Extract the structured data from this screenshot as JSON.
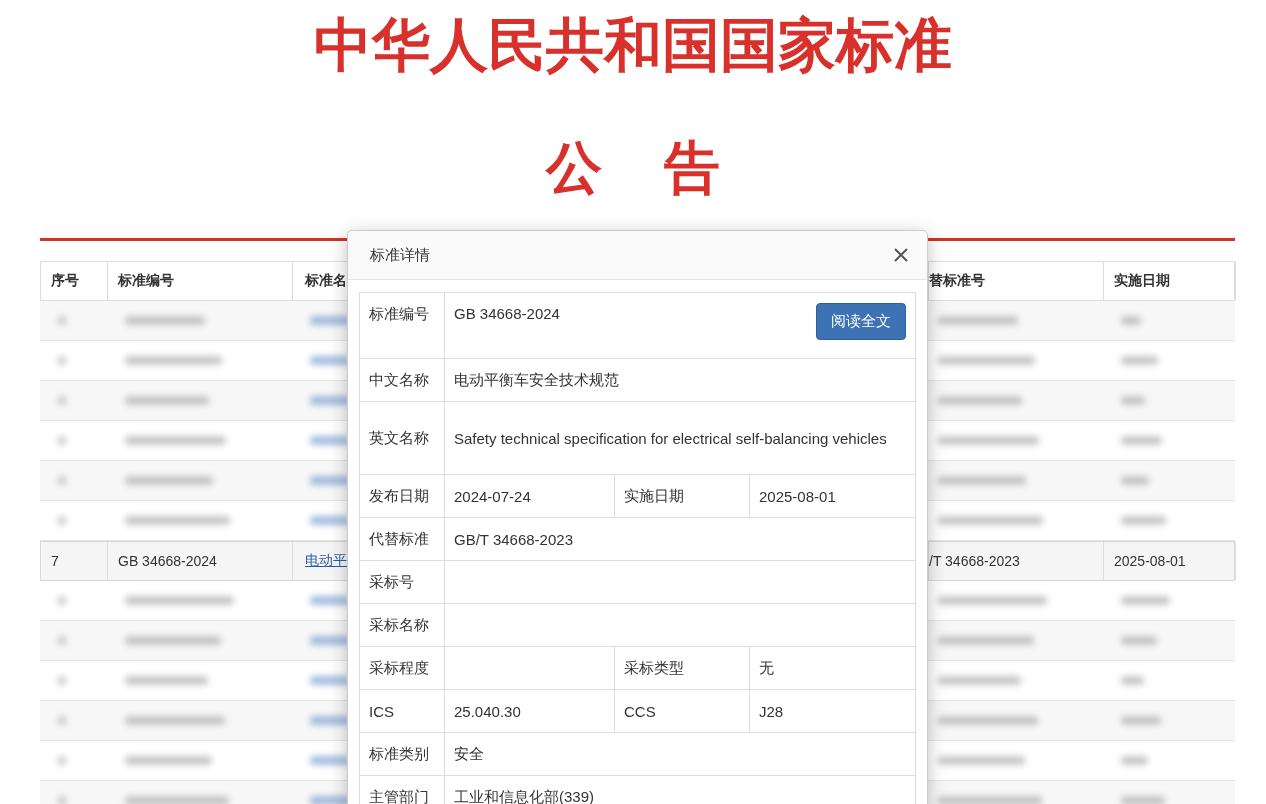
{
  "page": {
    "title": "中华人民共和国国家标准",
    "subtitle": "公告"
  },
  "table": {
    "columns": [
      "序号",
      "标准编号",
      "标准名",
      "",
      "替标准号",
      "实施日期"
    ],
    "rows": [
      {
        "kind": "blurred"
      },
      {
        "kind": "blurred"
      },
      {
        "kind": "blurred"
      },
      {
        "kind": "blurred"
      },
      {
        "kind": "blurred"
      },
      {
        "kind": "blurred"
      },
      {
        "kind": "data",
        "cells": [
          "7",
          "GB 34668-2024",
          "电动平",
          "",
          "/T 34668-2023",
          "2025-08-01"
        ]
      },
      {
        "kind": "blurred"
      },
      {
        "kind": "blurred"
      },
      {
        "kind": "blurred"
      },
      {
        "kind": "blurred"
      },
      {
        "kind": "blurred"
      },
      {
        "kind": "blurred"
      }
    ]
  },
  "dialog": {
    "title": "标准详情",
    "read_button": "阅读全文",
    "fields": [
      {
        "label": "标准编号",
        "value": "GB 34668-2024"
      },
      {
        "label": "中文名称",
        "value": "电动平衡车安全技术规范"
      },
      {
        "label": "英文名称",
        "value": "Safety technical specification for electrical self-balancing vehicles"
      },
      {
        "label": "发布日期",
        "value": "2024-07-24",
        "label_2": "实施日期",
        "value_2": "2025-08-01"
      },
      {
        "label": "代替标准",
        "value": "GB/T 34668-2023"
      },
      {
        "label": "采标号"
      },
      {
        "label": "采标名称"
      },
      {
        "label": "采标程度",
        "label_2": "采标类型",
        "value_2": "无"
      },
      {
        "label": "ICS",
        "value": "25.040.30",
        "label_2": "CCS",
        "value_2": "J28"
      },
      {
        "label": "标准类别",
        "value": "安全"
      },
      {
        "label": "主管部门",
        "value": "工业和信息化部(339)"
      }
    ]
  }
}
